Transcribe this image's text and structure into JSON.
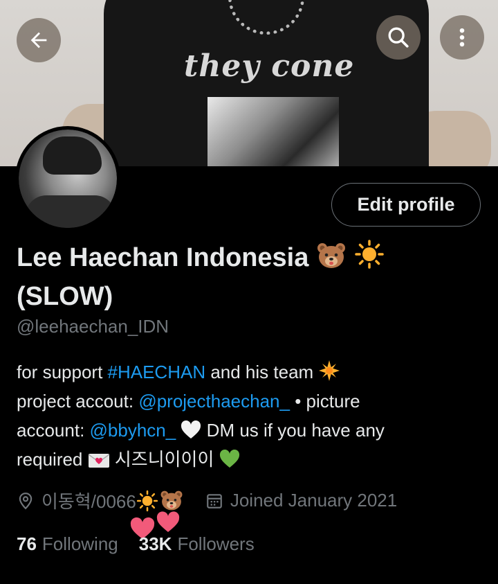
{
  "banner": {
    "shirt_text": "they cone"
  },
  "header": {
    "back_icon": "arrow-left-icon",
    "search_icon": "search-icon",
    "more_icon": "more-vertical-icon"
  },
  "profile": {
    "edit_label": "Edit profile",
    "name_line1": "Lee Haechan Indonesia",
    "name_line2": "(SLOW)",
    "handle": "@leehaechan_IDN",
    "bio": {
      "l1_a": "for support ",
      "l1_hashtag": "#HAECHAN",
      "l1_b": " and his team",
      "l2_a": "project accout: ",
      "l2_mention": "@projecthaechan_",
      "l2_b": " • picture",
      "l3_a": "account: ",
      "l3_mention": "@bbyhcn_",
      "l3_b": " DM us if you have any",
      "l4_a": "required ",
      "l4_korean": " 시즈니이이이 "
    },
    "location": "이동혁/0066",
    "joined": "Joined January 2021",
    "following_count": "76",
    "following_label": "Following",
    "followers_count": "33K",
    "followers_label": "Followers"
  },
  "colors": {
    "background": "#000000",
    "text_primary": "#e7e9ea",
    "text_secondary": "#71767b",
    "link": "#1d9bf0",
    "border": "#6c7278"
  }
}
